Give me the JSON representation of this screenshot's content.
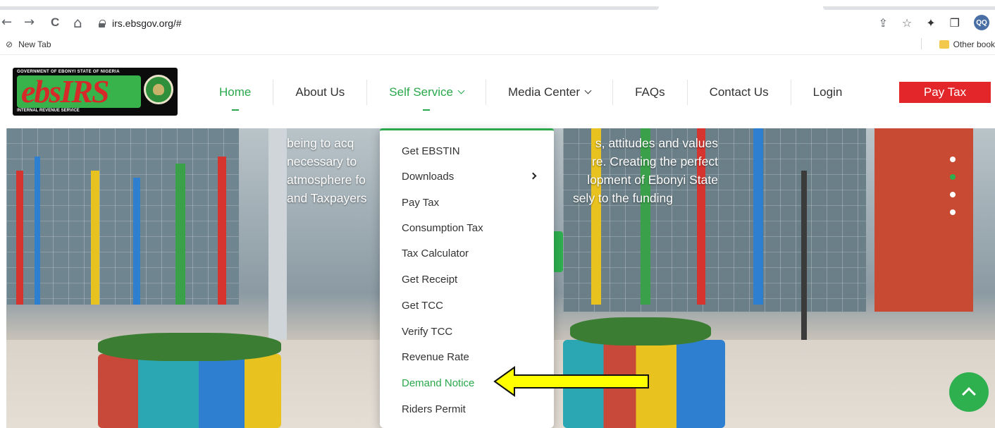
{
  "browser": {
    "back_glyph": "←",
    "forward_glyph": "→",
    "reload_glyph": "C",
    "home_glyph": "⌂",
    "url": "irs.ebsgov.org/#",
    "share_glyph": "⇪",
    "star_glyph": "☆",
    "extensions_glyph": "✦",
    "sidepanel_glyph": "❐",
    "profile_initials": "QQ",
    "bookmarks": {
      "new_tab_glyph": "⊘",
      "new_tab_label": "New Tab",
      "other_label": "Other book"
    }
  },
  "logo": {
    "top_line": "GOVERNMENT OF EBONYI STATE OF NIGERIA",
    "wordmark": "ebsIRS",
    "bottom_line": "INTERNAL REVENUE SERVICE"
  },
  "nav": {
    "home": "Home",
    "about": "About Us",
    "self_service": "Self Service",
    "media_center": "Media Center",
    "faqs": "FAQs",
    "contact": "Contact Us",
    "login": "Login",
    "pay_tax": "Pay Tax"
  },
  "hero": {
    "line1_left": "being to acq",
    "line1_right": "s, attitudes and values",
    "line2_left": "necessary to",
    "line2_right": "re. Creating the perfect",
    "line3_left": "atmosphere fo",
    "line3_right": "lopment of Ebonyi State",
    "line4_left": "and Taxpayers",
    "line4_right": "sely to the funding",
    "active_slide": 2,
    "slide_count": 4
  },
  "dropdown": {
    "items": [
      "Get EBSTIN",
      "Downloads",
      "Pay Tax",
      "Consumption Tax",
      "Tax Calculator",
      "Get Receipt",
      "Get TCC",
      "Verify TCC",
      "Revenue Rate",
      "Demand Notice",
      "Riders Permit"
    ],
    "highlighted": "Demand Notice"
  },
  "colors": {
    "brand_green": "#2aa84b",
    "pay_tax_red": "#e3262a",
    "annotation_arrow": "#ffff00"
  }
}
